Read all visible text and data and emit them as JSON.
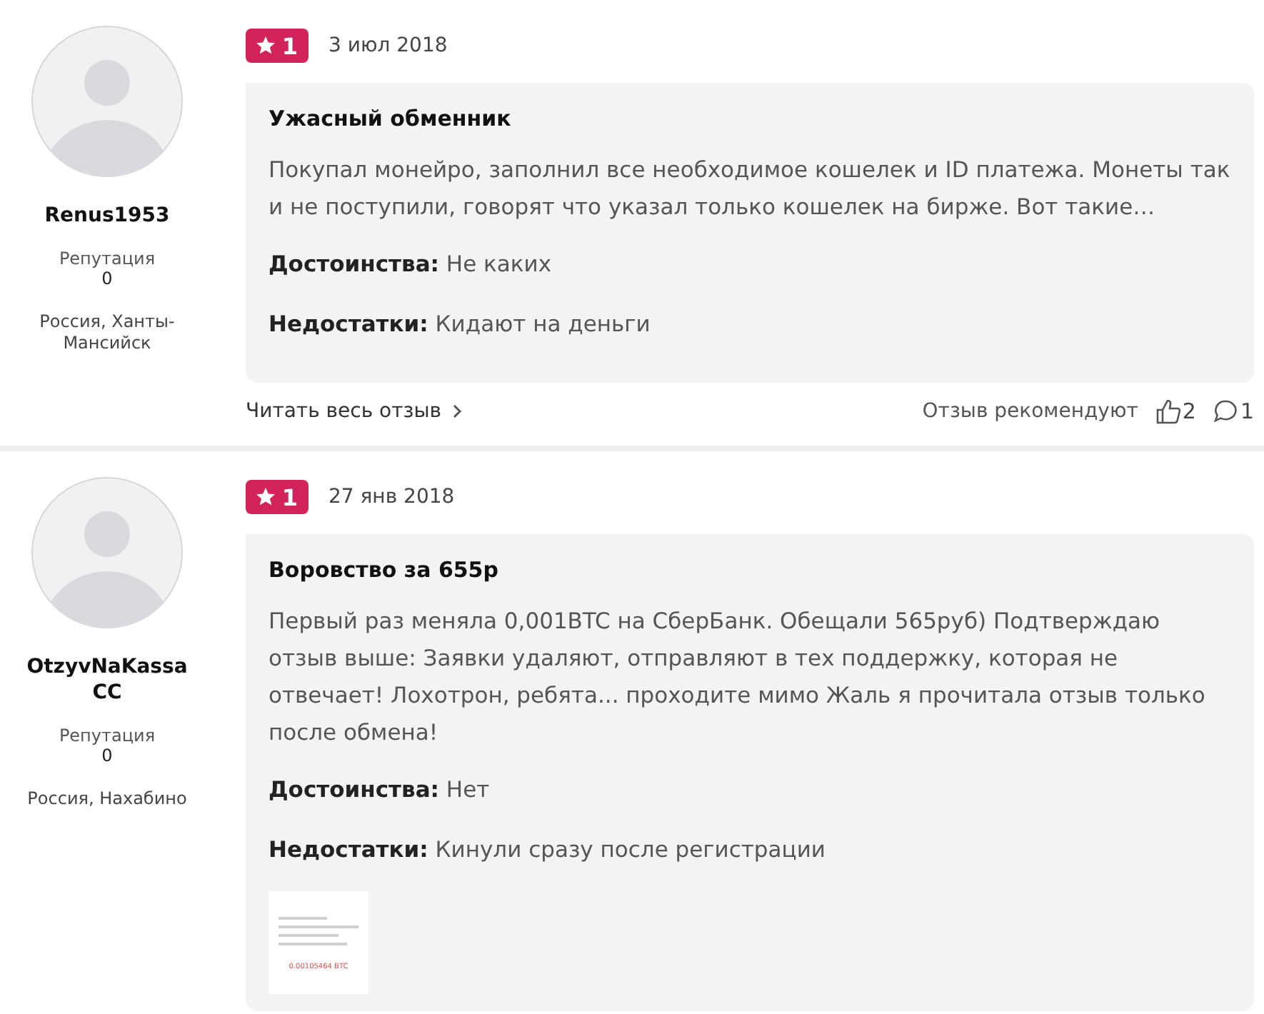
{
  "reviews": [
    {
      "author": {
        "name": "Renus1953",
        "reputation_label": "Репутация",
        "reputation": "0",
        "location": "Россия, Ханты-Мансийск"
      },
      "rating": "1",
      "date": "3 июл 2018",
      "title": "Ужасный обменник",
      "text": "Покупал монейро, заполнил все необходимое кошелек и ID платежа. Монеты так и не поступили, говорят что указал только кошелек на бирже. Вот такие…",
      "pros_label": "Достоинства:",
      "pros": "Не каких",
      "cons_label": "Недостатки:",
      "cons": "Кидают на деньги",
      "read_more": "Читать весь отзыв",
      "recommend_label": "Отзыв рекомендуют",
      "likes": "2",
      "comments": "1"
    },
    {
      "author": {
        "name": "OtzyvNaKassaCC",
        "reputation_label": "Репутация",
        "reputation": "0",
        "location": "Россия, Нахабино"
      },
      "rating": "1",
      "date": "27 янв 2018",
      "title": "Воровство за 655р",
      "text": "Первый раз меняла 0,001BTC на СберБанк. Обещали 565руб) Подтверждаю отзыв выше: Заявки удаляют, отправляют в тех поддержку, которая не отвечает! Лохотрон, ребята... проходите мимо Жаль я прочитала отзыв только после обмена!",
      "pros_label": "Достоинства:",
      "pros": "Нет",
      "cons_label": "Недостатки:",
      "cons": "Кинули сразу после регистрации",
      "attachment": {
        "amount": "0.00105464 BTC"
      }
    }
  ]
}
